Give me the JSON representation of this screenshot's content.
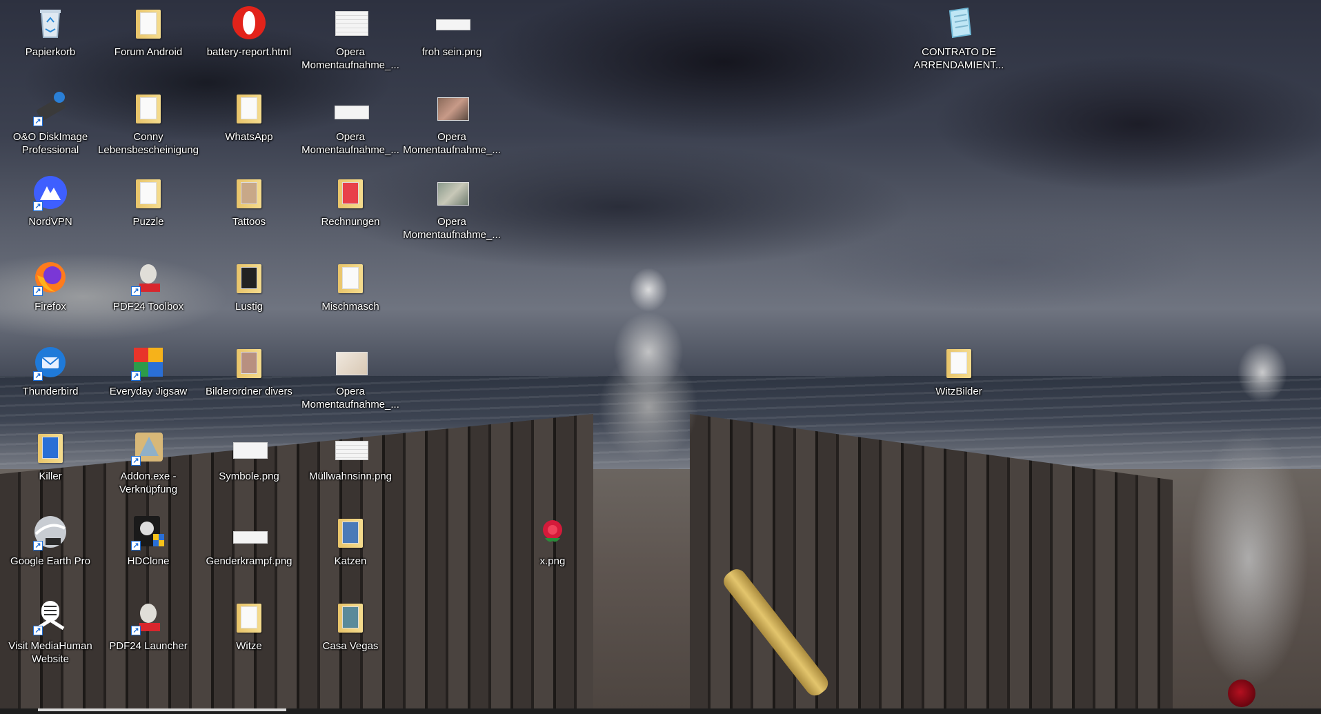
{
  "desktop": {
    "icons": [
      {
        "label": "Papierkorb",
        "icon": "recycle-bin-icon"
      },
      {
        "label": "Forum Android",
        "icon": "folder-icon"
      },
      {
        "label": "battery-report.html",
        "icon": "opera-icon"
      },
      {
        "label": "Opera Momentaufnahme_...",
        "icon": "image-file-icon"
      },
      {
        "label": "froh sein.png",
        "icon": "image-file-icon"
      },
      {
        "label": "CONTRATO DE ARRENDAMIENT...",
        "icon": "notepad-icon"
      },
      {
        "label": "O&O DiskImage Professional",
        "icon": "diskimage-icon"
      },
      {
        "label": "Conny Lebensbescheinigung",
        "icon": "folder-icon"
      },
      {
        "label": "WhatsApp",
        "icon": "folder-icon"
      },
      {
        "label": "Opera Momentaufnahme_...",
        "icon": "image-file-icon"
      },
      {
        "label": "Opera Momentaufnahme_...",
        "icon": "image-file-icon"
      },
      {
        "label": "NordVPN",
        "icon": "nordvpn-icon"
      },
      {
        "label": "Puzzle",
        "icon": "folder-icon"
      },
      {
        "label": "Tattoos",
        "icon": "folder-icon"
      },
      {
        "label": "Rechnungen",
        "icon": "folder-icon"
      },
      {
        "label": "Opera Momentaufnahme_...",
        "icon": "image-file-icon"
      },
      {
        "label": "Firefox",
        "icon": "firefox-icon"
      },
      {
        "label": "PDF24 Toolbox",
        "icon": "pdf24-icon"
      },
      {
        "label": "Lustig",
        "icon": "folder-icon"
      },
      {
        "label": "Mischmasch",
        "icon": "folder-icon"
      },
      {
        "label": "Thunderbird",
        "icon": "thunderbird-icon"
      },
      {
        "label": "Everyday Jigsaw",
        "icon": "jigsaw-icon"
      },
      {
        "label": "Bilderordner divers",
        "icon": "folder-icon"
      },
      {
        "label": "Opera Momentaufnahme_...",
        "icon": "image-file-icon"
      },
      {
        "label": "WitzBilder",
        "icon": "folder-icon"
      },
      {
        "label": "Killer",
        "icon": "folder-icon"
      },
      {
        "label": "Addon.exe - Verknüpfung",
        "icon": "addon-icon"
      },
      {
        "label": "Symbole.png",
        "icon": "image-file-icon"
      },
      {
        "label": "Müllwahnsinn.png",
        "icon": "image-file-icon"
      },
      {
        "label": "Google Earth Pro",
        "icon": "google-earth-icon"
      },
      {
        "label": "HDClone",
        "icon": "hdclone-icon"
      },
      {
        "label": "Genderkrampf.png",
        "icon": "image-file-icon"
      },
      {
        "label": "Katzen",
        "icon": "folder-icon"
      },
      {
        "label": "x.png",
        "icon": "rose-image-icon"
      },
      {
        "label": "Visit MediaHuman Website",
        "icon": "mediahuman-icon"
      },
      {
        "label": "PDF24 Launcher",
        "icon": "pdf24-icon"
      },
      {
        "label": "Witze",
        "icon": "folder-icon"
      },
      {
        "label": "Casa Vegas",
        "icon": "folder-icon"
      }
    ],
    "colors": {
      "label_text": "#ffffff",
      "folder": "#f0d27a",
      "shortcut_arrow": "#1e6fd9",
      "opera_red": "#e2231a"
    }
  }
}
